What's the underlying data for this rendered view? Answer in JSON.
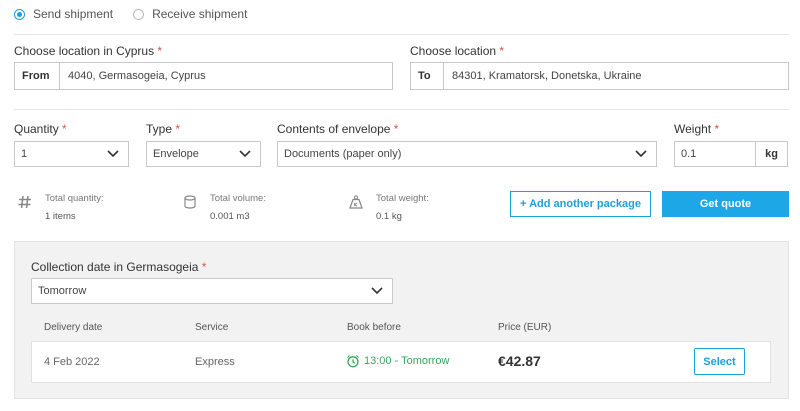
{
  "shipment_mode": {
    "options": [
      {
        "label": "Send shipment",
        "selected": true
      },
      {
        "label": "Receive shipment",
        "selected": false
      }
    ]
  },
  "from": {
    "label": "Choose location in Cyprus",
    "required_mark": "*",
    "prefix": "From",
    "value": "4040, Germasogeia, Cyprus"
  },
  "to": {
    "label": "Choose location",
    "required_mark": "*",
    "prefix": "To",
    "value": "84301, Kramatorsk, Donetska, Ukraine"
  },
  "package": {
    "quantity": {
      "label": "Quantity",
      "required_mark": "*",
      "value": "1"
    },
    "type": {
      "label": "Type",
      "required_mark": "*",
      "value": "Envelope"
    },
    "contents": {
      "label": "Contents of envelope",
      "required_mark": "*",
      "value": "Documents (paper only)"
    },
    "weight": {
      "label": "Weight",
      "required_mark": "*",
      "value": "0.1",
      "unit": "kg"
    }
  },
  "summary": {
    "quantity": {
      "icon": "hash-icon",
      "label": "Total quantity:",
      "value": "1 items"
    },
    "volume": {
      "icon": "cylinder-icon",
      "label": "Total volume:",
      "value": "0.001 m3"
    },
    "weight": {
      "icon": "weight-icon",
      "label": "Total weight:",
      "value": "0.1 kg"
    }
  },
  "actions": {
    "add_package": "+ Add another package",
    "get_quote": "Get quote"
  },
  "collection": {
    "label": "Collection date in Germasogeia",
    "required_mark": "*",
    "value": "Tomorrow"
  },
  "results": {
    "columns": [
      "Delivery date",
      "Service",
      "Book before",
      "Price (EUR)"
    ],
    "rows": [
      {
        "delivery_date": "4 Feb 2022",
        "service": "Express",
        "book_before": "13:00 - Tomorrow",
        "price": "€42.87",
        "action": "Select"
      }
    ]
  },
  "colors": {
    "accent": "#1ea7e6",
    "required": "#d9534f",
    "book_before": "#3aa55b"
  }
}
